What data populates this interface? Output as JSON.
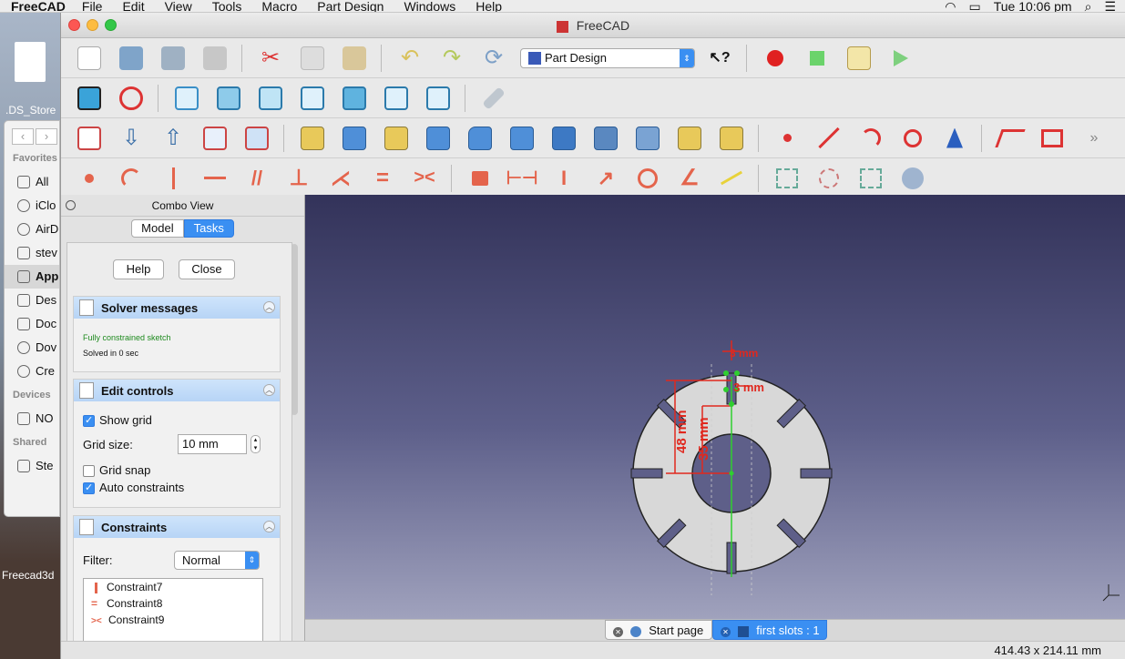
{
  "menubar": {
    "app_name": "FreeCAD",
    "items": [
      "File",
      "Edit",
      "View",
      "Tools",
      "Macro",
      "Part Design",
      "Windows",
      "Help"
    ],
    "clock": "Tue 10:06 pm"
  },
  "desktop": {
    "file_label": ".DS_Store",
    "dock_label": "Freecad3d"
  },
  "finder": {
    "favorites_label": "Favorites",
    "favorites": [
      "All",
      "iClo",
      "AirD",
      "stev",
      "App",
      "Des",
      "Doc",
      "Dov",
      "Cre"
    ],
    "devices_label": "Devices",
    "devices": [
      "NO"
    ],
    "shared_label": "Shared",
    "shared": [
      "Ste"
    ]
  },
  "window": {
    "title": "FreeCAD",
    "workbench": "Part Design"
  },
  "combo": {
    "title": "Combo View",
    "tabs": [
      "Model",
      "Tasks"
    ],
    "help_label": "Help",
    "close_label": "Close",
    "solver": {
      "title": "Solver messages",
      "status": "Fully constrained sketch",
      "time": "Solved in 0 sec"
    },
    "edit": {
      "title": "Edit controls",
      "show_grid": "Show grid",
      "grid_size_label": "Grid size:",
      "grid_size_value": "10 mm",
      "grid_snap": "Grid snap",
      "auto_constraints": "Auto constraints"
    },
    "constraints": {
      "title": "Constraints",
      "filter_label": "Filter:",
      "filter_value": "Normal",
      "items": [
        "Constraint7",
        "Constraint8",
        "Constraint9"
      ]
    }
  },
  "sketch": {
    "dim_48": "48 mm",
    "dim_35": "35 mm",
    "dim_top": "3 mm",
    "dim_side": "3 mm"
  },
  "doc_tabs": [
    "Start page",
    "first slots : 1"
  ],
  "status": {
    "dimensions": "414.43 x 214.11 mm"
  },
  "colors": {
    "accent": "#3a8ff2",
    "constraint_red": "#e0281e",
    "axis_green": "#2fcf2f"
  }
}
